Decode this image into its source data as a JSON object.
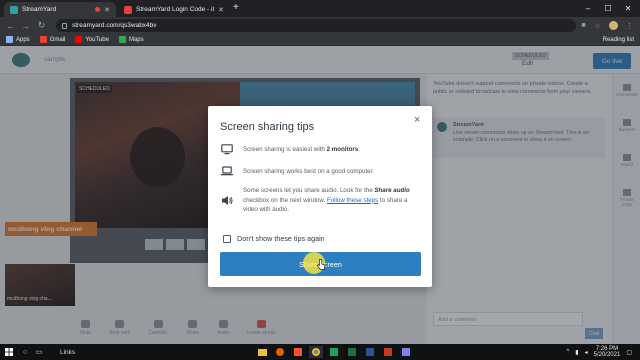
{
  "browser": {
    "tabs": [
      {
        "title": "StreamYard",
        "active": true,
        "favicon_color": "#2ba3a3"
      },
      {
        "title": "StreamYard Login Code - itsmep",
        "active": false,
        "favicon_color": "#ea4335"
      }
    ],
    "new_tab_label": "+",
    "url": "streamyard.com/qs3wabx4bv",
    "bookmarks": [
      {
        "label": "Apps",
        "icon": "apps-grid-icon",
        "color": "#8ab4f8"
      },
      {
        "label": "Gmail",
        "icon": "gmail-icon",
        "color": "#ea4335"
      },
      {
        "label": "YouTube",
        "icon": "youtube-icon",
        "color": "#ff0000"
      },
      {
        "label": "Maps",
        "icon": "maps-icon",
        "color": "#34a853"
      }
    ],
    "reading_list": "Reading list"
  },
  "studio": {
    "broadcast_title": "sample",
    "status_badge": "SCHEDULED",
    "edit_label": "Edit",
    "go_live_label": "Go live",
    "lower_third": "mcdhong vlog channel",
    "thumbnail_name": "mcdhong vlog cha...",
    "comments_notice": "YouTube doesn't support comments on private videos. Create a public or unlisted broadcast to view comments from your viewers.",
    "streamyard_card_name": "StreamYard",
    "streamyard_card_text": "Live viewer comments show up on StreamYard. This is an example. Click on a comment to show it on screen.",
    "comment_placeholder": "Add a comment",
    "chat_button": "Chat",
    "side_tabs": [
      "Comments",
      "Banners",
      "Brand",
      "Private Chat"
    ],
    "bottom_controls": [
      "Mute",
      "Stop cam",
      "Cam/Mic",
      "Share",
      "Invite",
      "Leave studio"
    ]
  },
  "modal": {
    "title": "Screen sharing tips",
    "close": "×",
    "tip1_prefix": "Screen sharing is easiest with ",
    "tip1_bold": "2 monitors",
    "tip1_suffix": ".",
    "tip2": "Screen sharing works best on a good computer.",
    "tip3_prefix": "Some screens let you share audio. Look for the ",
    "tip3_bold": "Share audio",
    "tip3_mid": " checkbox on the next window. ",
    "tip3_link": "Follow these steps",
    "tip3_suffix": " to share a video with audio.",
    "checkbox_label": "Don't show these tips again",
    "share_button": "Share screen"
  },
  "taskbar": {
    "search_label": "Links",
    "time": "7:26 PM",
    "date": "5/20/2021"
  }
}
